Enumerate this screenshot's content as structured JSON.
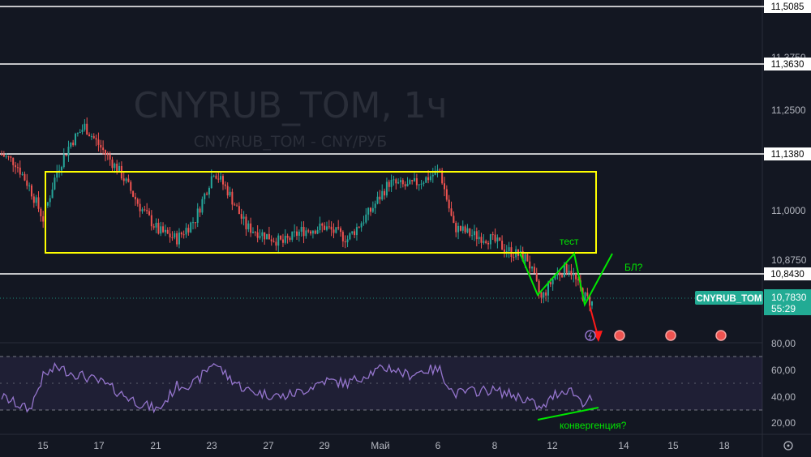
{
  "watermark": {
    "title": "CNYRUB_TOM, 1ч",
    "subtitle": "CNY/RUB_TOM - CNY/РУБ"
  },
  "colors": {
    "background": "#131722",
    "bull": "#26a69a",
    "bear": "#ef5350",
    "rsi": "#9575cd",
    "box": "#ffff00",
    "green_lines": "#00e600",
    "red_arrow": "#ff1a1a",
    "price_label": "#22ab94"
  },
  "price_axis": {
    "ticks": [
      "11,2500",
      "11,0000",
      "10,8750"
    ],
    "partial_ticks": [
      "11,3750"
    ]
  },
  "horizontal_levels": [
    {
      "value": 11.5085,
      "label": "11,5085"
    },
    {
      "value": 11.363,
      "label": "11,3630"
    },
    {
      "value": 11.138,
      "label": "11,1380"
    },
    {
      "value": 10.843,
      "label": "10,8430"
    }
  ],
  "current_price": {
    "symbol": "CNYRUB_TOM",
    "price": "10,7830",
    "countdown": "55:29"
  },
  "rsi_axis": {
    "ticks": [
      "80,00",
      "60,00",
      "40,00",
      "20,00"
    ]
  },
  "time_axis": {
    "labels": [
      "15",
      "17",
      "21",
      "23",
      "27",
      "29",
      "Май",
      "6",
      "8",
      "12",
      "14",
      "15",
      "18"
    ]
  },
  "annotations": {
    "test": "тест",
    "bl": "БЛ?",
    "convergence": "конвергенция?"
  },
  "chart_data": {
    "type": "candlestick",
    "symbol": "CNYRUB_TOM",
    "interval": "1ч",
    "range_box": {
      "from_bar": 5,
      "to_bar": 210,
      "high": 11.11,
      "low": 10.86
    },
    "ylim": [
      10.68,
      11.52
    ],
    "rsi": {
      "ylim": [
        15,
        85
      ],
      "bands": [
        30,
        50,
        70
      ]
    },
    "trend": [
      [
        0,
        11.14
      ],
      [
        6,
        11.12
      ],
      [
        12,
        11.06
      ],
      [
        18,
        10.98
      ],
      [
        24,
        11.1
      ],
      [
        30,
        11.17
      ],
      [
        36,
        11.21
      ],
      [
        44,
        11.15
      ],
      [
        52,
        11.09
      ],
      [
        60,
        11.01
      ],
      [
        68,
        10.95
      ],
      [
        76,
        10.93
      ],
      [
        84,
        10.98
      ],
      [
        92,
        11.1
      ],
      [
        98,
        11.05
      ],
      [
        106,
        10.96
      ],
      [
        114,
        10.94
      ],
      [
        122,
        10.92
      ],
      [
        130,
        10.95
      ],
      [
        140,
        10.96
      ],
      [
        150,
        10.93
      ],
      [
        160,
        11.0
      ],
      [
        168,
        11.07
      ],
      [
        176,
        11.06
      ],
      [
        184,
        11.08
      ],
      [
        190,
        11.1
      ],
      [
        196,
        10.96
      ],
      [
        204,
        10.94
      ],
      [
        212,
        10.93
      ],
      [
        220,
        10.9
      ],
      [
        228,
        10.88
      ],
      [
        234,
        10.78
      ],
      [
        240,
        10.84
      ],
      [
        246,
        10.86
      ],
      [
        252,
        10.79
      ],
      [
        256,
        10.77
      ]
    ],
    "rsi_trend": [
      [
        0,
        40
      ],
      [
        6,
        35
      ],
      [
        12,
        30
      ],
      [
        18,
        55
      ],
      [
        24,
        62
      ],
      [
        30,
        58
      ],
      [
        36,
        55
      ],
      [
        44,
        50
      ],
      [
        52,
        42
      ],
      [
        60,
        35
      ],
      [
        68,
        30
      ],
      [
        76,
        48
      ],
      [
        84,
        50
      ],
      [
        92,
        66
      ],
      [
        98,
        55
      ],
      [
        106,
        45
      ],
      [
        114,
        42
      ],
      [
        122,
        40
      ],
      [
        130,
        44
      ],
      [
        140,
        52
      ],
      [
        150,
        50
      ],
      [
        160,
        58
      ],
      [
        168,
        62
      ],
      [
        176,
        56
      ],
      [
        184,
        60
      ],
      [
        190,
        60
      ],
      [
        196,
        42
      ],
      [
        204,
        44
      ],
      [
        212,
        45
      ],
      [
        220,
        42
      ],
      [
        228,
        38
      ],
      [
        234,
        30
      ],
      [
        240,
        42
      ],
      [
        246,
        46
      ],
      [
        252,
        36
      ],
      [
        256,
        38
      ]
    ]
  }
}
